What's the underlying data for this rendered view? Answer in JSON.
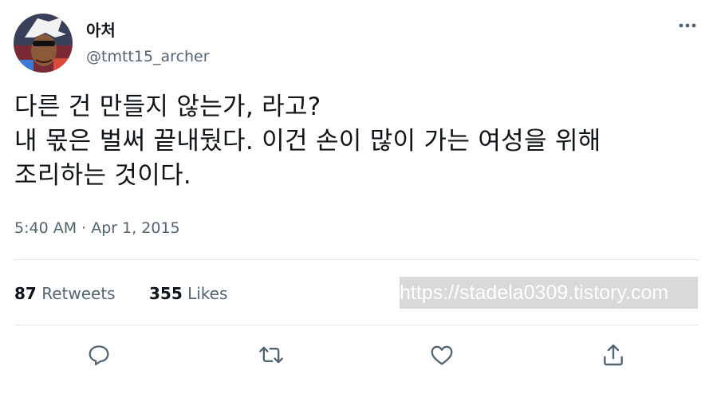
{
  "author": {
    "display_name": "아처",
    "handle": "@tmtt15_archer"
  },
  "tweet": {
    "lines": [
      "다른 건 만들지 않는가, 라고?",
      "내 몫은 벌써 끝내뒀다. 이건 손이 많이 가는 여성을 위해",
      "조리하는 것이다."
    ],
    "timestamp": "5:40 AM · Apr 1, 2015"
  },
  "stats": {
    "retweets_count": "87",
    "retweets_label": "Retweets",
    "likes_count": "355",
    "likes_label": "Likes"
  },
  "watermark": "https://stadela0309.tistory.com",
  "icons": {
    "more": "more-horizontal-icon",
    "reply": "reply-icon",
    "retweet": "retweet-icon",
    "like": "like-icon",
    "share": "share-icon"
  },
  "colors": {
    "text": "#0f1419",
    "secondary": "#536471",
    "icon": "#536471",
    "divider": "#e1e6ea"
  }
}
